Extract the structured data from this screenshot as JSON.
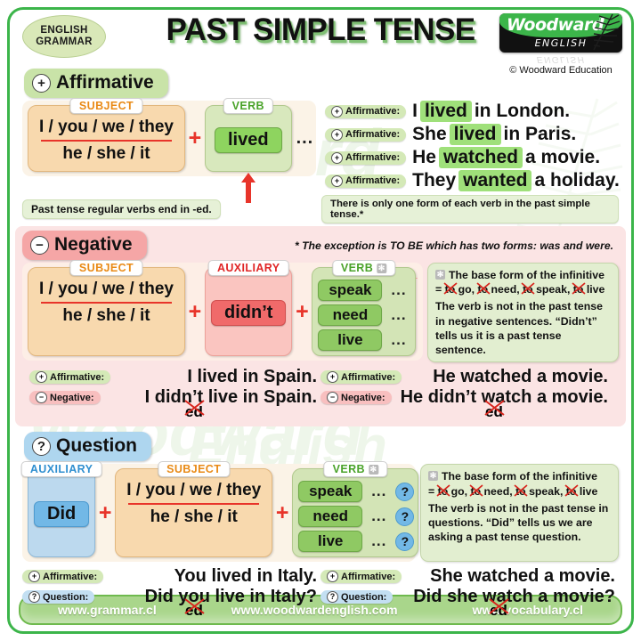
{
  "header": {
    "badge_line1": "ENGLISH",
    "badge_line2": "GRAMMAR",
    "title": "PAST SIMPLE TENSE",
    "logo_word": "Woodward",
    "logo_reg": "®",
    "logo_sub": "ENGLISH",
    "logo_reflection": "ENGLISH",
    "copyright": "© Woodward Education"
  },
  "colors": {
    "frame_green": "#3cb54a",
    "affirmative_green": "#c9e3a8",
    "negative_red": "#f5a6a6",
    "question_blue": "#aed6ef",
    "subject_orange": "#f8d9ae",
    "verb_green": "#8fc963",
    "arrow_red": "#e8342a",
    "footer_green": "#a9d68b"
  },
  "affirmative": {
    "heading": "Affirmative",
    "symbol": "+",
    "formula": {
      "subject_label": "SUBJECT",
      "subject_line1": "I / you / we / they",
      "subject_line2": "he / she / it",
      "plus": "+",
      "verb_label": "VERB",
      "verb": "lived",
      "dots": "..."
    },
    "note_left": "Past tense regular verbs end in -ed.",
    "note_left_bold": "regular",
    "note_right": "There is only one form of each verb in the past simple tense.*",
    "examples": [
      {
        "tag": "Affirmative:",
        "symbol": "+",
        "before": "I",
        "highlight": "lived",
        "after": "in London."
      },
      {
        "tag": "Affirmative:",
        "symbol": "+",
        "before": "She",
        "highlight": "lived",
        "after": "in Paris."
      },
      {
        "tag": "Affirmative:",
        "symbol": "+",
        "before": "He",
        "highlight": "watched",
        "after": "a movie."
      },
      {
        "tag": "Affirmative:",
        "symbol": "+",
        "before": "They",
        "highlight": "wanted",
        "after": "a holiday."
      }
    ]
  },
  "exception_note": "* The exception is TO BE which has two forms: was and were.",
  "negative": {
    "heading": "Negative",
    "symbol": "−",
    "formula": {
      "subject_label": "SUBJECT",
      "subject_line1": "I / you / we / they",
      "subject_line2": "he / she / it",
      "plus": "+",
      "auxiliary_label": "AUXILIARY",
      "auxiliary": "didn’t",
      "verb_label": "VERB",
      "verbs": [
        "speak",
        "need",
        "live"
      ],
      "dots": "..."
    },
    "infobox": {
      "line1": "The base form of the infinitive",
      "line2_prefix": "= ",
      "infinitives": [
        "to go,",
        "to need,",
        "to speak,",
        "to live"
      ],
      "struck_word": "to",
      "line3": "The verb is not in the past tense in negative sentences. “Didn’t” tells us it is a past tense sentence."
    },
    "compare_left": {
      "aff_tag": "Affirmative:",
      "aff_symbol": "+",
      "aff_before": "I",
      "aff_highlight": "lived",
      "aff_after": "in Spain.",
      "neg_tag": "Negative:",
      "neg_symbol": "−",
      "neg_before": "I",
      "neg_aux": "didn’t",
      "neg_verb": "live",
      "neg_after": "in Spain.",
      "struck_suffix": "ed"
    },
    "compare_right": {
      "aff_tag": "Affirmative:",
      "aff_symbol": "+",
      "aff_before": "He",
      "aff_highlight": "watched",
      "aff_after": "a movie.",
      "neg_tag": "Negative:",
      "neg_symbol": "−",
      "neg_before": "He",
      "neg_aux": "didn’t",
      "neg_verb": "watch",
      "neg_after": "a movie.",
      "struck_suffix": "ed"
    }
  },
  "question": {
    "heading": "Question",
    "symbol": "?",
    "formula": {
      "auxiliary_label": "AUXILIARY",
      "auxiliary": "Did",
      "plus": "+",
      "subject_label": "SUBJECT",
      "subject_line1": "I / you / we / they",
      "subject_line2": "he / she / it",
      "verb_label": "VERB",
      "verbs": [
        "speak",
        "need",
        "live"
      ],
      "dots": "...",
      "qmark": "?"
    },
    "infobox": {
      "line1": "The base form of the infinitive",
      "line2_prefix": "= ",
      "infinitives": [
        "to go,",
        "to need,",
        "to speak,",
        "to live"
      ],
      "struck_word": "to",
      "line3": "The verb is not in the past tense in questions. “Did” tells us we are asking a past tense question."
    },
    "compare_left": {
      "aff_tag": "Affirmative:",
      "aff_symbol": "+",
      "aff_before": "You",
      "aff_highlight": "lived",
      "aff_after": "in Italy.",
      "que_tag": "Question:",
      "que_symbol": "?",
      "que_aux": "Did",
      "que_subject": "you",
      "que_verb": "live",
      "que_after": "in Italy",
      "que_qmark": "?",
      "struck_suffix": "ed"
    },
    "compare_right": {
      "aff_tag": "Affirmative:",
      "aff_symbol": "+",
      "aff_before": "She",
      "aff_highlight": "watched",
      "aff_after": "a movie.",
      "que_tag": "Question:",
      "que_symbol": "?",
      "que_aux": "Did",
      "que_subject": "she",
      "que_verb": "watch",
      "que_after": "a movie",
      "que_qmark": "?",
      "struck_suffix": "ed"
    }
  },
  "footer": {
    "links": [
      "www.grammar.cl",
      "www.woodwardenglish.com",
      "www.vocabulary.cl"
    ]
  },
  "watermarks": {
    "w1": "Woodward",
    "w2": "ENGLISH",
    "w3": "Woodward",
    "w4": "English"
  }
}
